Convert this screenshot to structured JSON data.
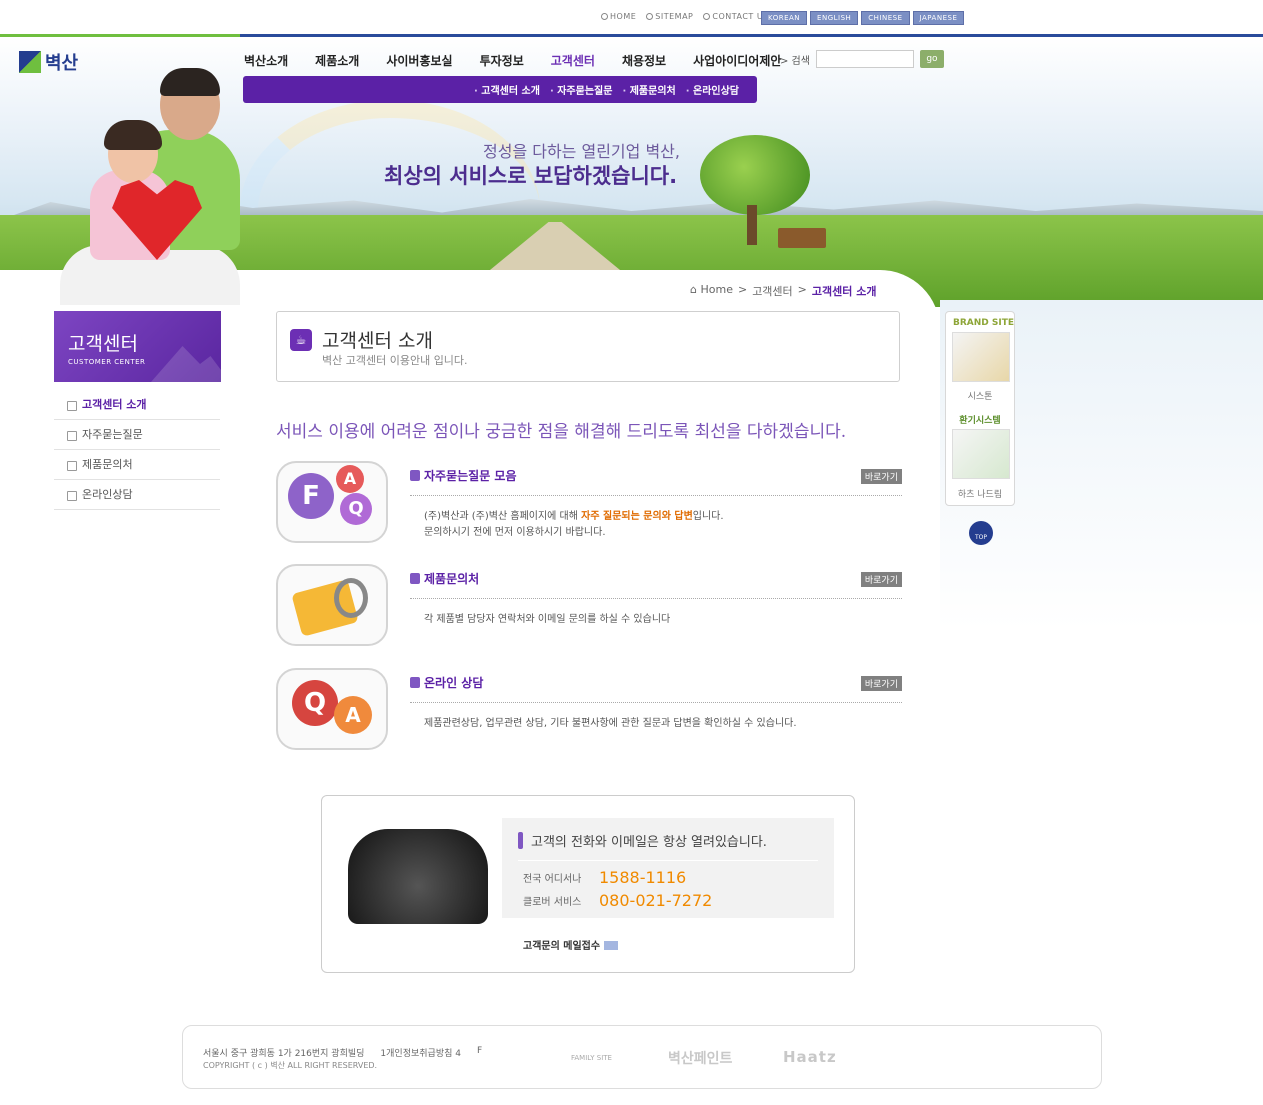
{
  "util": {
    "home": "HOME",
    "sitemap": "SITEMAP",
    "contact": "CONTACT US"
  },
  "langs": [
    "KOREAN",
    "ENGLISH",
    "CHINESE",
    "JAPANESE"
  ],
  "logo": "벽산",
  "gnb": [
    "벽산소개",
    "제품소개",
    "사이버홍보실",
    "투자정보",
    "고객센터",
    "채용정보",
    "사업아이디어제안"
  ],
  "sub": [
    "고객센터 소개",
    "자주묻는질문",
    "제품문의처",
    "온라인상담"
  ],
  "search": {
    "label": "> 검색",
    "go": "go"
  },
  "hero": {
    "line1": "정성을 다하는 열린기업 벽산,",
    "line2": "최상의 서비스로 보답하겠습니다."
  },
  "breadcrumb": {
    "home": "Home",
    "sep": ">",
    "mid": "고객센터",
    "cur": "고객센터 소개"
  },
  "side": {
    "title": "고객센터",
    "subtitle": "CUSTOMER CENTER",
    "items": [
      "고객센터 소개",
      "자주묻는질문",
      "제품문의처",
      "온라인상담"
    ]
  },
  "head": {
    "title": "고객센터 소개",
    "desc": "벽산 고객센터 이용안내 입니다."
  },
  "lead": "서비스 이용에 어려운 점이나 궁금한 점을 해결해 드리도록 최선을 다하겠습니다.",
  "items": [
    {
      "title": "자주묻는질문 모음",
      "go": "바로가기",
      "d1a": "(주)벽산과 (주)벽산 홈페이지에 대해 ",
      "d1b": "자주 질문되는 문의와 답변",
      "d1c": "입니다.",
      "d2": "문의하시기 전에 먼저 이용하시기 바랍니다."
    },
    {
      "title": "제품문의처",
      "go": "바로가기",
      "d1": "각 제품별 담당자 연락처와 이메일 문의를 하실 수 있습니다"
    },
    {
      "title": "온라인 상담",
      "go": "바로가기",
      "d1": "제품관련상담, 업무관련 상담, 기타 불편사항에 관한 질문과 답변을 확인하실 수 있습니다."
    }
  ],
  "contact": {
    "msg": "고객의 전화와 이메일은 항상 열려있습니다.",
    "lab1": "전국 어디서나",
    "num1": "1588-1116",
    "lab2": "클로버 서비스",
    "num2": "080-021-7272",
    "mail": "고객문의 메일접수"
  },
  "footer": {
    "addr": "서울시 중구 광희동 1가 216번지 광희빌딩",
    "policy": "1개인정보취급방침 4",
    "f": "F",
    "copy": "COPYRIGHT ( c ) 벽산 ALL RIGHT RESERVED.",
    "family": "FAMILY SITE",
    "brand1": "벽산페인트",
    "brand2": "Haatz"
  },
  "brand": {
    "title": "BRAND SITE",
    "cap1": "시스톤",
    "sub": "환기시스템",
    "cap2": "하츠 나드림"
  },
  "top": "TOP"
}
